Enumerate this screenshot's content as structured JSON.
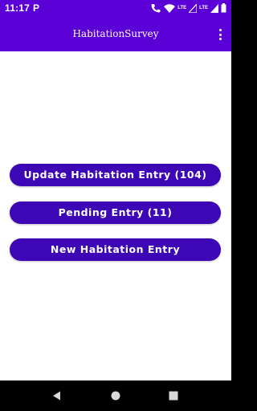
{
  "status_bar": {
    "time": "11:17",
    "notification_icon": "parking-p-icon",
    "lte_label_1": "LTE",
    "lte_label_2": "LTE",
    "icons": [
      "call-lte-icon",
      "wifi-icon",
      "lte-signal-icon",
      "signal-icon",
      "battery-icon"
    ]
  },
  "app_bar": {
    "title": "HabitationSurvey",
    "menu_icon": "overflow-menu-icon"
  },
  "actions": {
    "update_label": "Update Habitation Entry (104)",
    "pending_label": "Pending Entry (11)",
    "new_label": "New Habitation Entry"
  },
  "nav_bar": {
    "icons": [
      "back-icon",
      "home-icon",
      "recents-icon"
    ]
  },
  "colors": {
    "app_bar": "#5a00d6",
    "button": "#3d07b5",
    "button_text": "#ffffff",
    "background": "#ffffff",
    "nav_bar": "#000000"
  }
}
